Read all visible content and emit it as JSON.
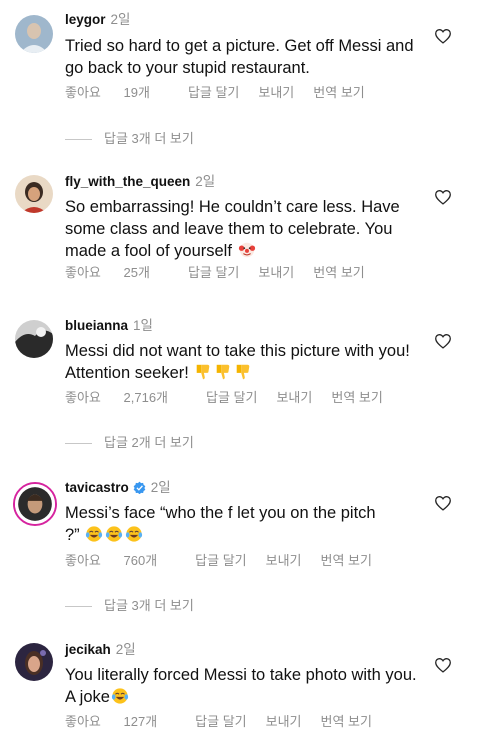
{
  "ui": {
    "like_prefix": "좋아요",
    "reply": "답글 달기",
    "send": "보내기",
    "translate": "번역 보기"
  },
  "comments": [
    {
      "username": "leygor",
      "time": "2일",
      "text": "Tried so hard to get a picture. Get off Messi and go back to your stupid restaurant.",
      "likes": "19개",
      "replies_label": "답글 3개 더 보기"
    },
    {
      "username": "fly_with_the_queen",
      "time": "2일",
      "text": "So embarrassing! He couldn’t care less. Have some class and leave them to celebrate. You made a fool of yourself",
      "emoji": [
        "clown-face"
      ],
      "likes": "25개"
    },
    {
      "username": "bluеianna",
      "time": "1일",
      "text": "Messi did not want to take this picture with you! Attention seeker!",
      "emoji": [
        "thumbs-down",
        "thumbs-down",
        "thumbs-down"
      ],
      "likes": "2,716개",
      "replies_label": "답글 2개 더 보기"
    },
    {
      "username": "tavicastro",
      "verified": true,
      "time": "2일",
      "text": "Messi’s face “who the f let you on the pitch ?”",
      "emoji": [
        "tears-of-joy",
        "tears-of-joy",
        "tears-of-joy"
      ],
      "likes": "760개",
      "replies_label": "답글 3개 더 보기"
    },
    {
      "username": "jecikah",
      "time": "2일",
      "text": "You literally forced Messi to take photo with you. A joke",
      "emoji": [
        "tears-of-joy"
      ],
      "likes": "127개"
    }
  ],
  "colors": {
    "text": "#111111",
    "muted": "#8e8e8e",
    "verified": "#3897f0",
    "divider": "#c7c7c7"
  }
}
